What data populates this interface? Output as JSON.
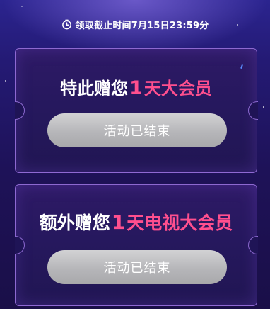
{
  "deadline": {
    "icon": "clock-icon",
    "text": "领取截止时间7月15日23:59分"
  },
  "offers": [
    {
      "title_prefix": "特此赠您",
      "title_number": "1",
      "title_suffix": "天大会员",
      "button_label": "活动已结束"
    },
    {
      "title_prefix": "额外赠您",
      "title_number": "1",
      "title_suffix": "天电视大会员",
      "button_label": "活动已结束"
    }
  ],
  "colors": {
    "highlight": "#ff4f8e",
    "button": "#b8b8bb",
    "card_border": "#a078e6",
    "background": "#1e1258"
  }
}
